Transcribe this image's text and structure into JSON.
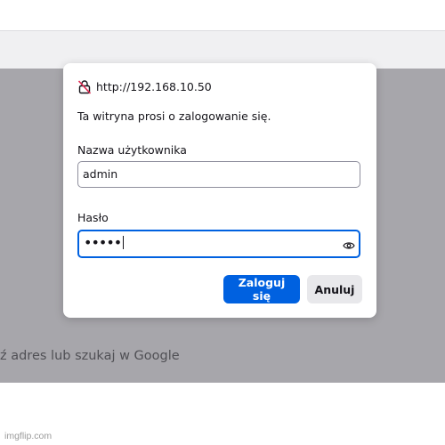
{
  "dialog": {
    "url": "http://192.168.10.50",
    "prompt": "Ta witryna prosi o zalogowanie się.",
    "username_label": "Nazwa użytkownika",
    "username_value": "admin",
    "password_label": "Hasło",
    "password_value": "•••••",
    "login_button": "Zaloguj się",
    "cancel_button": "Anuluj"
  },
  "page": {
    "search_hint": "ź adres lub szukaj w Google"
  },
  "watermark": "imgflip.com",
  "icons": {
    "site": "lock-insecure-icon",
    "reveal": "eye-icon"
  },
  "colors": {
    "accent": "#0061e0",
    "overlay": "#a7a6ab"
  }
}
